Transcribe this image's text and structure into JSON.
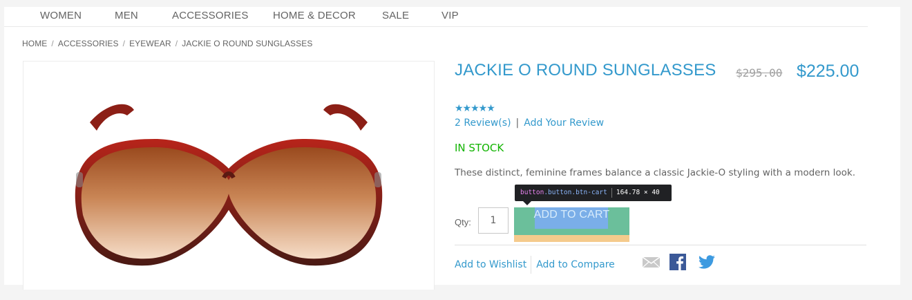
{
  "nav": {
    "items": [
      {
        "label": "WOMEN"
      },
      {
        "label": "MEN"
      },
      {
        "label": "ACCESSORIES"
      },
      {
        "label": "HOME & DECOR"
      },
      {
        "label": "SALE"
      },
      {
        "label": "VIP"
      }
    ]
  },
  "breadcrumb": {
    "separator": "/",
    "items": [
      {
        "label": "HOME"
      },
      {
        "label": "ACCESSORIES"
      },
      {
        "label": "EYEWEAR"
      },
      {
        "label": "JACKIE O ROUND SUNGLASSES"
      }
    ]
  },
  "product": {
    "name": "JACKIE O ROUND SUNGLASSES",
    "old_price": "$295.00",
    "price": "$225.00",
    "stars": "★★★★★",
    "rating_stars": 5,
    "reviews_label": "2 Review(s)",
    "reviews_separator": "|",
    "add_review_label": "Add Your Review",
    "stock": "IN STOCK",
    "description": "These distinct, feminine frames balance a classic Jackie-O styling with a modern look."
  },
  "devtools_tooltip": {
    "tag": "button",
    "classes": ".button.btn-cart",
    "size": "164.78 × 40"
  },
  "purchase": {
    "qty_label": "Qty:",
    "qty_value": "1",
    "add_to_cart_label": "ADD TO CART"
  },
  "actions": {
    "wishlist_label": "Add to Wishlist",
    "compare_label": "Add to Compare"
  },
  "social": {
    "icons": [
      "email-icon",
      "facebook-icon",
      "twitter-icon"
    ]
  },
  "colors": {
    "accent": "#3399cc",
    "in_stock": "#11b400",
    "text": "#636363"
  }
}
